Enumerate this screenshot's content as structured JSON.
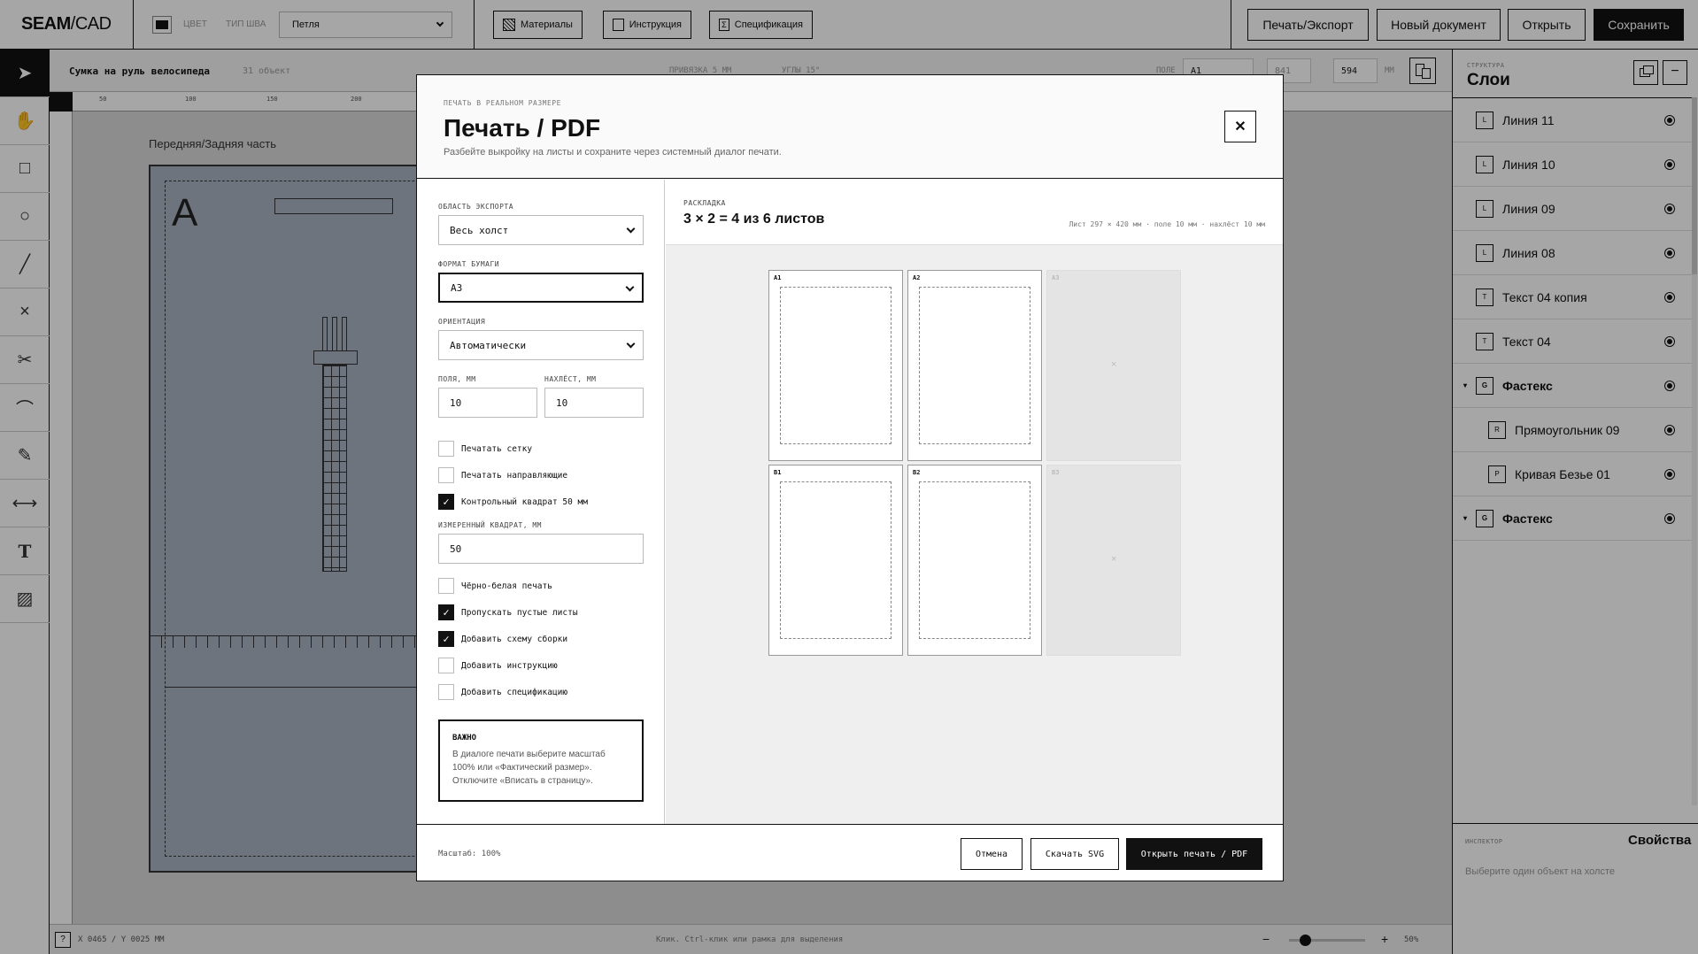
{
  "app": {
    "logo_bold": "SEAM",
    "logo_rest": "/CAD"
  },
  "topbar": {
    "color_label": "ЦВЕТ",
    "seam_label": "ТИП ШВА",
    "seam_value": "Петля",
    "materials": "Материалы",
    "instructions": "Инструкция",
    "spec": "Спецификация",
    "print_export": "Печать/Экспорт",
    "new_doc": "Новый документ",
    "open": "Открыть",
    "save": "Сохранить"
  },
  "canvas": {
    "doc_title": "Сумка на руль велосипеда",
    "obj_count": "31 объект",
    "snap_label": "ПРИВЯЗКА 5 ММ",
    "angle_label": "УГЛЫ 15°",
    "field_label": "ПОЛЕ",
    "field_format": "A1",
    "field_w": "841",
    "field_h": "594",
    "unit": "ММ",
    "ruler_ticks": [
      "50",
      "100",
      "150",
      "200"
    ],
    "part_title": "Передняя/Задняя часть",
    "part_letter": "A",
    "coords": "X 0465 / Y 0025 ММ",
    "hint": "Клик. Ctrl-клик или рамка для выделения",
    "zoom": "50%"
  },
  "layers": {
    "section_label": "СТРУКТУРА",
    "title": "Слои",
    "items": [
      {
        "tag": "L",
        "name": "Линия 11"
      },
      {
        "tag": "L",
        "name": "Линия 10"
      },
      {
        "tag": "L",
        "name": "Линия 09"
      },
      {
        "tag": "L",
        "name": "Линия 08"
      },
      {
        "tag": "T",
        "name": "Текст 04 копия"
      },
      {
        "tag": "T",
        "name": "Текст 04"
      },
      {
        "tag": "G",
        "name": "Фастекс"
      },
      {
        "tag": "R",
        "name": "Прямоугольник 09"
      },
      {
        "tag": "P",
        "name": "Кривая Безье 01"
      },
      {
        "tag": "G",
        "name": "Фастекс"
      }
    ]
  },
  "inspector": {
    "label": "ИНСПЕКТОР",
    "title": "Свойства",
    "hint": "Выберите один объект на холсте"
  },
  "modal": {
    "eyebrow": "ПЕЧАТЬ В РЕАЛЬНОМ РАЗМЕРЕ",
    "title": "Печать / PDF",
    "subtitle": "Разбейте выкройку на листы и сохраните через системный диалог печати.",
    "export_area_label": "ОБЛАСТЬ ЭКСПОРТА",
    "export_area_value": "Весь холст",
    "paper_label": "ФОРМАТ БУМАГИ",
    "paper_value": "A3",
    "orientation_label": "ОРИЕНТАЦИЯ",
    "orientation_value": "Автоматически",
    "margins_label": "ПОЛЯ, ММ",
    "margins_value": "10",
    "overlap_label": "НАХЛЁСТ, ММ",
    "overlap_value": "10",
    "measured_label": "ИЗМЕРЕННЫЙ КВАДРАТ, ММ",
    "measured_value": "50",
    "checks1": [
      {
        "label": "Печатать сетку",
        "checked": false
      },
      {
        "label": "Печатать направляющие",
        "checked": false
      },
      {
        "label": "Контрольный квадрат 50 мм",
        "checked": true
      }
    ],
    "checks2": [
      {
        "label": "Чёрно-белая печать",
        "checked": false
      },
      {
        "label": "Пропускать пустые листы",
        "checked": true
      },
      {
        "label": "Добавить схему сборки",
        "checked": true
      },
      {
        "label": "Добавить инструкцию",
        "checked": false
      },
      {
        "label": "Добавить спецификацию",
        "checked": false
      }
    ],
    "notice_title": "ВАЖНО",
    "notice_text": "В диалоге печати выберите масштаб 100% или «Фактический размер». Отключите «Вписать в страницу».",
    "layout_label": "РАСКЛАДКА",
    "layout_title": "3 × 2 = 4 из 6 листов",
    "layout_meta": "Лист 297 × 420 мм · поле 10 мм · нахлёст 10 мм",
    "sheets": [
      {
        "id": "A1",
        "active": true
      },
      {
        "id": "A2",
        "active": true
      },
      {
        "id": "A3",
        "active": false
      },
      {
        "id": "B1",
        "active": true
      },
      {
        "id": "B2",
        "active": true
      },
      {
        "id": "B3",
        "active": false
      }
    ],
    "scale": "Масштаб: 100%",
    "cancel": "Отмена",
    "download_svg": "Скачать SVG",
    "open_print": "Открыть печать / PDF",
    "close_symbol": "✕"
  }
}
